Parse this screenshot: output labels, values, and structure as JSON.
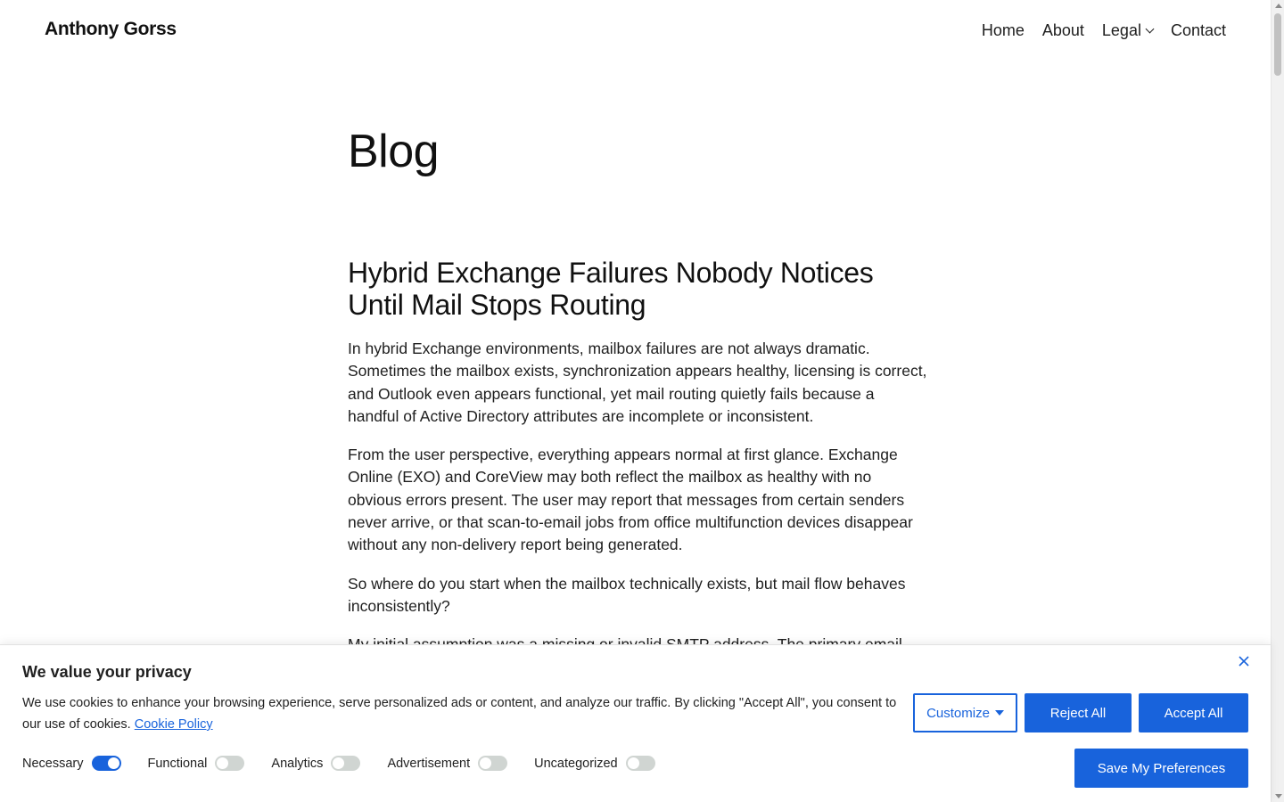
{
  "header": {
    "site_title": "Anthony Gorss",
    "nav": [
      {
        "label": "Home"
      },
      {
        "label": "About"
      },
      {
        "label": "Legal",
        "has_dropdown": true
      },
      {
        "label": "Contact"
      }
    ]
  },
  "main": {
    "page_title": "Blog",
    "post": {
      "title": "Hybrid Exchange Failures Nobody Notices Until Mail Stops Routing",
      "paragraphs": [
        "In hybrid Exchange environments, mailbox failures are not always dramatic. Sometimes the mailbox exists, synchronization appears healthy, licensing is correct, and Outlook even appears functional, yet mail routing quietly fails because a handful of Active Directory attributes are incomplete or inconsistent.",
        "From the user perspective, everything appears normal at first glance. Exchange Online (EXO) and CoreView may both reflect the mailbox as healthy with no obvious errors present. The user may report that messages from certain senders never arrive, or that scan-to-email jobs from office multifunction devices disappear without any non-delivery report being generated.",
        "So where do you start when the mailbox technically exists, but mail flow behaves inconsistently?",
        "My initial assumption was a missing or invalid SMTP address. The primary email"
      ]
    }
  },
  "cookie_banner": {
    "title": "We value your privacy",
    "text": "We use cookies to enhance your browsing experience, serve personalized ads or content, and analyze our traffic. By clicking \"Accept All\", you consent to our use of cookies.",
    "policy_link": "Cookie Policy",
    "close_icon": "close-icon",
    "buttons": {
      "customize": "Customize",
      "reject": "Reject All",
      "accept": "Accept All",
      "save": "Save My Preferences"
    },
    "categories": [
      {
        "label": "Necessary",
        "enabled": true
      },
      {
        "label": "Functional",
        "enabled": false
      },
      {
        "label": "Analytics",
        "enabled": false
      },
      {
        "label": "Advertisement",
        "enabled": false
      },
      {
        "label": "Uncategorized",
        "enabled": false
      }
    ],
    "accent_color": "#1863dc"
  }
}
